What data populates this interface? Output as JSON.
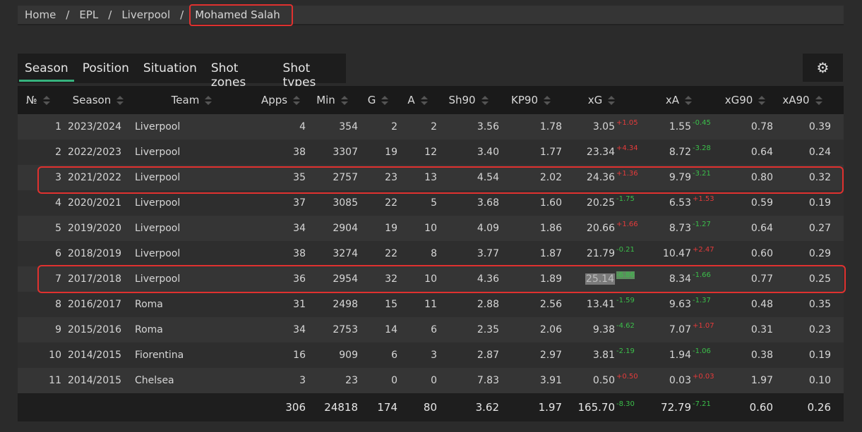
{
  "breadcrumb": {
    "home": "Home",
    "league": "EPL",
    "team": "Liverpool",
    "player": "Mohamed Salah",
    "separator": "/"
  },
  "tabs": [
    "Season",
    "Position",
    "Situation",
    "Shot zones",
    "Shot types"
  ],
  "active_tab": "Season",
  "settings_icon": "⚙",
  "columns": {
    "no": "№",
    "season": "Season",
    "team": "Team",
    "apps": "Apps",
    "min": "Min",
    "g": "G",
    "a": "A",
    "sh90": "Sh90",
    "kp90": "KP90",
    "xg": "xG",
    "xa": "xA",
    "xg90": "xG90",
    "xa90": "xA90"
  },
  "rows": [
    {
      "no": "1",
      "season": "2023/2024",
      "team": "Liverpool",
      "apps": "4",
      "min": "354",
      "g": "2",
      "a": "2",
      "sh90": "3.56",
      "kp90": "1.78",
      "xg": "3.05",
      "xg_diff": "+1.05",
      "xa": "1.55",
      "xa_diff": "-0.45",
      "xg90": "0.78",
      "xa90": "0.39"
    },
    {
      "no": "2",
      "season": "2022/2023",
      "team": "Liverpool",
      "apps": "38",
      "min": "3307",
      "g": "19",
      "a": "12",
      "sh90": "3.40",
      "kp90": "1.77",
      "xg": "23.34",
      "xg_diff": "+4.34",
      "xa": "8.72",
      "xa_diff": "-3.28",
      "xg90": "0.64",
      "xa90": "0.24"
    },
    {
      "no": "3",
      "season": "2021/2022",
      "team": "Liverpool",
      "apps": "35",
      "min": "2757",
      "g": "23",
      "a": "13",
      "sh90": "4.54",
      "kp90": "2.02",
      "xg": "24.36",
      "xg_diff": "+1.36",
      "xa": "9.79",
      "xa_diff": "-3.21",
      "xg90": "0.80",
      "xa90": "0.32"
    },
    {
      "no": "4",
      "season": "2020/2021",
      "team": "Liverpool",
      "apps": "37",
      "min": "3085",
      "g": "22",
      "a": "5",
      "sh90": "3.68",
      "kp90": "1.60",
      "xg": "20.25",
      "xg_diff": "-1.75",
      "xa": "6.53",
      "xa_diff": "+1.53",
      "xg90": "0.59",
      "xa90": "0.19"
    },
    {
      "no": "5",
      "season": "2019/2020",
      "team": "Liverpool",
      "apps": "34",
      "min": "2904",
      "g": "19",
      "a": "10",
      "sh90": "4.09",
      "kp90": "1.86",
      "xg": "20.66",
      "xg_diff": "+1.66",
      "xa": "8.73",
      "xa_diff": "-1.27",
      "xg90": "0.64",
      "xa90": "0.27"
    },
    {
      "no": "6",
      "season": "2018/2019",
      "team": "Liverpool",
      "apps": "38",
      "min": "3274",
      "g": "22",
      "a": "8",
      "sh90": "3.77",
      "kp90": "1.87",
      "xg": "21.79",
      "xg_diff": "-0.21",
      "xa": "10.47",
      "xa_diff": "+2.47",
      "xg90": "0.60",
      "xa90": "0.29"
    },
    {
      "no": "7",
      "season": "2017/2018",
      "team": "Liverpool",
      "apps": "36",
      "min": "2954",
      "g": "32",
      "a": "10",
      "sh90": "4.36",
      "kp90": "1.89",
      "xg": "25.14",
      "xg_diff": "-6.86",
      "xa": "8.34",
      "xa_diff": "-1.66",
      "xg90": "0.77",
      "xa90": "0.25"
    },
    {
      "no": "8",
      "season": "2016/2017",
      "team": "Roma",
      "apps": "31",
      "min": "2498",
      "g": "15",
      "a": "11",
      "sh90": "2.88",
      "kp90": "2.56",
      "xg": "13.41",
      "xg_diff": "-1.59",
      "xa": "9.63",
      "xa_diff": "-1.37",
      "xg90": "0.48",
      "xa90": "0.35"
    },
    {
      "no": "9",
      "season": "2015/2016",
      "team": "Roma",
      "apps": "34",
      "min": "2753",
      "g": "14",
      "a": "6",
      "sh90": "2.35",
      "kp90": "2.06",
      "xg": "9.38",
      "xg_diff": "-4.62",
      "xa": "7.07",
      "xa_diff": "+1.07",
      "xg90": "0.31",
      "xa90": "0.23"
    },
    {
      "no": "10",
      "season": "2014/2015",
      "team": "Fiorentina",
      "apps": "16",
      "min": "909",
      "g": "6",
      "a": "3",
      "sh90": "2.87",
      "kp90": "2.97",
      "xg": "3.81",
      "xg_diff": "-2.19",
      "xa": "1.94",
      "xa_diff": "-1.06",
      "xg90": "0.38",
      "xa90": "0.19"
    },
    {
      "no": "11",
      "season": "2014/2015",
      "team": "Chelsea",
      "apps": "3",
      "min": "23",
      "g": "0",
      "a": "0",
      "sh90": "7.83",
      "kp90": "3.91",
      "xg": "0.50",
      "xg_diff": "+0.50",
      "xa": "0.03",
      "xa_diff": "+0.03",
      "xg90": "1.97",
      "xa90": "0.10"
    }
  ],
  "totals": {
    "apps": "306",
    "min": "24818",
    "g": "174",
    "a": "80",
    "sh90": "3.62",
    "kp90": "1.97",
    "xg": "165.70",
    "xg_diff": "-8.30",
    "xa": "72.79",
    "xa_diff": "-7.21",
    "xg90": "0.60",
    "xa90": "0.26"
  },
  "colors": {
    "positive_diff": "#e53b3b",
    "negative_diff": "#3bbf4a",
    "accent": "#36b37e",
    "highlight_box": "#e0312f"
  }
}
